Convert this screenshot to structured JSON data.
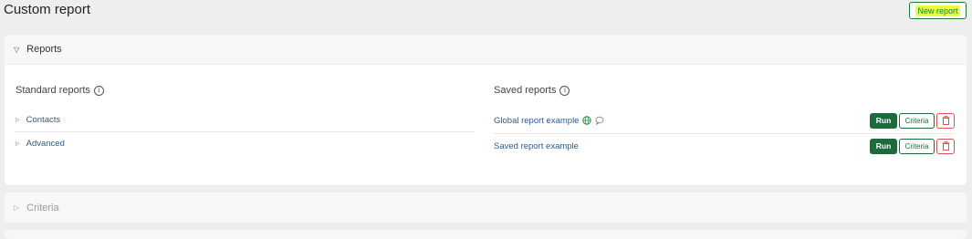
{
  "page": {
    "title": "Custom report"
  },
  "toolbar": {
    "new_report_label": "New report"
  },
  "reports_panel": {
    "title": "Reports",
    "standard": {
      "title": "Standard reports",
      "items": [
        {
          "label": "Contacts"
        },
        {
          "label": "Advanced"
        }
      ]
    },
    "saved": {
      "title": "Saved reports",
      "items": [
        {
          "name": "Global report example",
          "icons": [
            "globe-icon",
            "comment-icon"
          ],
          "run_label": "Run",
          "criteria_label": "Criteria"
        },
        {
          "name": "Saved report example",
          "icons": [],
          "run_label": "Run",
          "criteria_label": "Criteria"
        }
      ]
    }
  },
  "criteria_panel": {
    "title": "Criteria"
  },
  "colors": {
    "accent_green": "#1d6b3a",
    "highlight_yellow": "#e6ff3a",
    "danger_red": "#d9534f",
    "link_blue": "#2c5d8a"
  }
}
